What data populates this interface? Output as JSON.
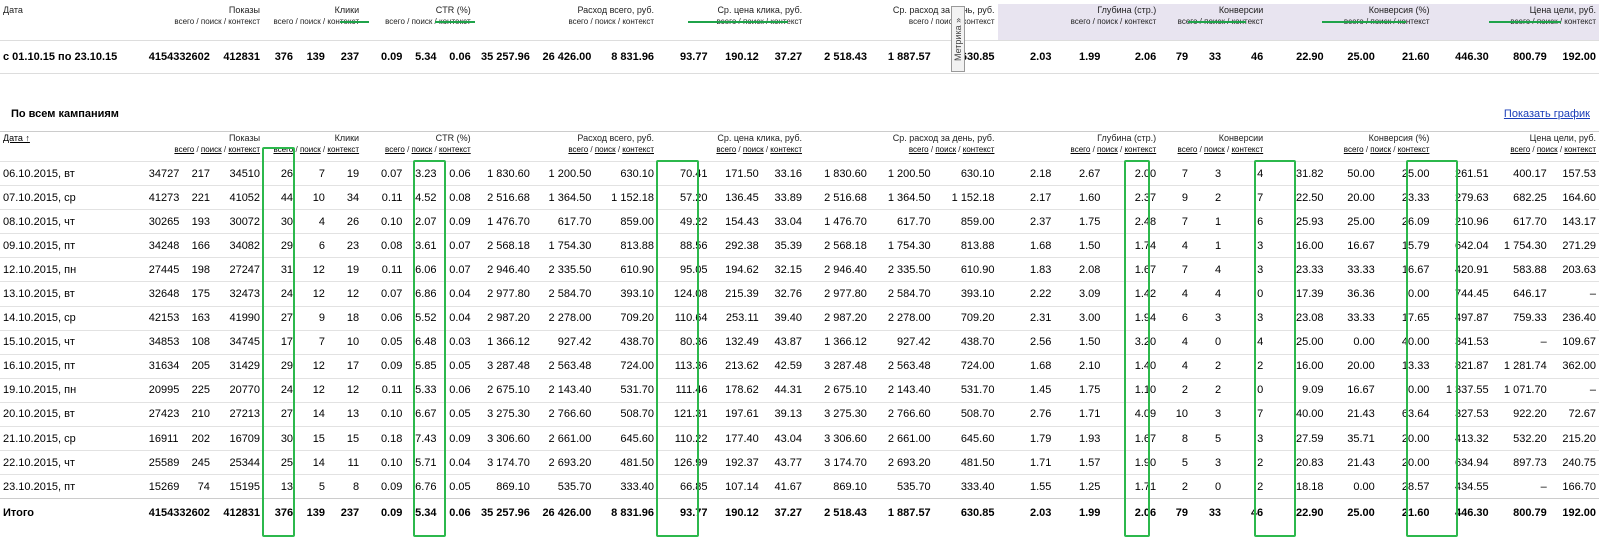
{
  "summary": {
    "date_header": "Дата",
    "subheader": "всего / поиск / контекст",
    "metrika_label": "Метрика »",
    "groups": [
      "Показы",
      "Клики",
      "CTR (%)",
      "Расход всего, руб.",
      "Ср. цена клика, руб.",
      "Ср. расход за день, руб.",
      "Глубина (стр.)",
      "Конверсии",
      "Конверсия (%)",
      "Цена цели, руб."
    ],
    "row": [
      "с 01.10.15 по 23.10.15",
      "415433",
      "2602",
      "412831",
      "376",
      "139",
      "237",
      "0.09",
      "5.34",
      "0.06",
      "35 257.96",
      "26 426.00",
      "8 831.96",
      "93.77",
      "190.12",
      "37.27",
      "2 518.43",
      "1 887.57",
      "630.85",
      "2.03",
      "1.99",
      "2.06",
      "79",
      "33",
      "46",
      "22.90",
      "25.00",
      "21.60",
      "446.30",
      "800.79",
      "192.00"
    ]
  },
  "section_title": "По всем кампаниям",
  "show_graph_link": "Показать график",
  "table": {
    "date_header": "Дата ↑",
    "sub_labels": [
      "всего",
      "поиск",
      "контекст"
    ],
    "groups": [
      "Показы",
      "Клики",
      "CTR (%)",
      "Расход всего, руб.",
      "Ср. цена клика, руб.",
      "Ср. расход за день, руб.",
      "Глубина (стр.)",
      "Конверсии",
      "Конверсия (%)",
      "Цена цели, руб."
    ],
    "rows": [
      [
        "06.10.2015, вт",
        "34727",
        "217",
        "34510",
        "26",
        "7",
        "19",
        "0.07",
        "3.23",
        "0.06",
        "1 830.60",
        "1 200.50",
        "630.10",
        "70.41",
        "171.50",
        "33.16",
        "1 830.60",
        "1 200.50",
        "630.10",
        "2.18",
        "2.67",
        "2.00",
        "7",
        "3",
        "4",
        "31.82",
        "50.00",
        "25.00",
        "261.51",
        "400.17",
        "157.53"
      ],
      [
        "07.10.2015, ср",
        "41273",
        "221",
        "41052",
        "44",
        "10",
        "34",
        "0.11",
        "4.52",
        "0.08",
        "2 516.68",
        "1 364.50",
        "1 152.18",
        "57.20",
        "136.45",
        "33.89",
        "2 516.68",
        "1 364.50",
        "1 152.18",
        "2.17",
        "1.60",
        "2.37",
        "9",
        "2",
        "7",
        "22.50",
        "20.00",
        "23.33",
        "279.63",
        "682.25",
        "164.60"
      ],
      [
        "08.10.2015, чт",
        "30265",
        "193",
        "30072",
        "30",
        "4",
        "26",
        "0.10",
        "2.07",
        "0.09",
        "1 476.70",
        "617.70",
        "859.00",
        "49.22",
        "154.43",
        "33.04",
        "1 476.70",
        "617.70",
        "859.00",
        "2.37",
        "1.75",
        "2.48",
        "7",
        "1",
        "6",
        "25.93",
        "25.00",
        "26.09",
        "210.96",
        "617.70",
        "143.17"
      ],
      [
        "09.10.2015, пт",
        "34248",
        "166",
        "34082",
        "29",
        "6",
        "23",
        "0.08",
        "3.61",
        "0.07",
        "2 568.18",
        "1 754.30",
        "813.88",
        "88.56",
        "292.38",
        "35.39",
        "2 568.18",
        "1 754.30",
        "813.88",
        "1.68",
        "1.50",
        "1.74",
        "4",
        "1",
        "3",
        "16.00",
        "16.67",
        "15.79",
        "642.04",
        "1 754.30",
        "271.29"
      ],
      [
        "12.10.2015, пн",
        "27445",
        "198",
        "27247",
        "31",
        "12",
        "19",
        "0.11",
        "6.06",
        "0.07",
        "2 946.40",
        "2 335.50",
        "610.90",
        "95.05",
        "194.62",
        "32.15",
        "2 946.40",
        "2 335.50",
        "610.90",
        "1.83",
        "2.08",
        "1.67",
        "7",
        "4",
        "3",
        "23.33",
        "33.33",
        "16.67",
        "420.91",
        "583.88",
        "203.63"
      ],
      [
        "13.10.2015, вт",
        "32648",
        "175",
        "32473",
        "24",
        "12",
        "12",
        "0.07",
        "6.86",
        "0.04",
        "2 977.80",
        "2 584.70",
        "393.10",
        "124.08",
        "215.39",
        "32.76",
        "2 977.80",
        "2 584.70",
        "393.10",
        "2.22",
        "3.09",
        "1.42",
        "4",
        "4",
        "0",
        "17.39",
        "36.36",
        "0.00",
        "744.45",
        "646.17",
        "–"
      ],
      [
        "14.10.2015, ср",
        "42153",
        "163",
        "41990",
        "27",
        "9",
        "18",
        "0.06",
        "5.52",
        "0.04",
        "2 987.20",
        "2 278.00",
        "709.20",
        "110.64",
        "253.11",
        "39.40",
        "2 987.20",
        "2 278.00",
        "709.20",
        "2.31",
        "3.00",
        "1.94",
        "6",
        "3",
        "3",
        "23.08",
        "33.33",
        "17.65",
        "497.87",
        "759.33",
        "236.40"
      ],
      [
        "15.10.2015, чт",
        "34853",
        "108",
        "34745",
        "17",
        "7",
        "10",
        "0.05",
        "6.48",
        "0.03",
        "1 366.12",
        "927.42",
        "438.70",
        "80.36",
        "132.49",
        "43.87",
        "1 366.12",
        "927.42",
        "438.70",
        "2.56",
        "1.50",
        "3.20",
        "4",
        "0",
        "4",
        "25.00",
        "0.00",
        "40.00",
        "341.53",
        "–",
        "109.67"
      ],
      [
        "16.10.2015, пт",
        "31634",
        "205",
        "31429",
        "29",
        "12",
        "17",
        "0.09",
        "5.85",
        "0.05",
        "3 287.48",
        "2 563.48",
        "724.00",
        "113.36",
        "213.62",
        "42.59",
        "3 287.48",
        "2 563.48",
        "724.00",
        "1.68",
        "2.10",
        "1.40",
        "4",
        "2",
        "2",
        "16.00",
        "20.00",
        "13.33",
        "821.87",
        "1 281.74",
        "362.00"
      ],
      [
        "19.10.2015, пн",
        "20995",
        "225",
        "20770",
        "24",
        "12",
        "12",
        "0.11",
        "5.33",
        "0.06",
        "2 675.10",
        "2 143.40",
        "531.70",
        "111.46",
        "178.62",
        "44.31",
        "2 675.10",
        "2 143.40",
        "531.70",
        "1.45",
        "1.75",
        "1.10",
        "2",
        "2",
        "0",
        "9.09",
        "16.67",
        "0.00",
        "1 337.55",
        "1 071.70",
        "–"
      ],
      [
        "20.10.2015, вт",
        "27423",
        "210",
        "27213",
        "27",
        "14",
        "13",
        "0.10",
        "6.67",
        "0.05",
        "3 275.30",
        "2 766.60",
        "508.70",
        "121.31",
        "197.61",
        "39.13",
        "3 275.30",
        "2 766.60",
        "508.70",
        "2.76",
        "1.71",
        "4.09",
        "10",
        "3",
        "7",
        "40.00",
        "21.43",
        "63.64",
        "327.53",
        "922.20",
        "72.67"
      ],
      [
        "21.10.2015, ср",
        "16911",
        "202",
        "16709",
        "30",
        "15",
        "15",
        "0.18",
        "7.43",
        "0.09",
        "3 306.60",
        "2 661.00",
        "645.60",
        "110.22",
        "177.40",
        "43.04",
        "3 306.60",
        "2 661.00",
        "645.60",
        "1.79",
        "1.93",
        "1.67",
        "8",
        "5",
        "3",
        "27.59",
        "35.71",
        "20.00",
        "413.32",
        "532.20",
        "215.20"
      ],
      [
        "22.10.2015, чт",
        "25589",
        "245",
        "25344",
        "25",
        "14",
        "11",
        "0.10",
        "5.71",
        "0.04",
        "3 174.70",
        "2 693.20",
        "481.50",
        "126.99",
        "192.37",
        "43.77",
        "3 174.70",
        "2 693.20",
        "481.50",
        "1.71",
        "1.57",
        "1.90",
        "5",
        "3",
        "2",
        "20.83",
        "21.43",
        "20.00",
        "634.94",
        "897.73",
        "240.75"
      ],
      [
        "23.10.2015, пт",
        "15269",
        "74",
        "15195",
        "13",
        "5",
        "8",
        "0.09",
        "6.76",
        "0.05",
        "869.10",
        "535.70",
        "333.40",
        "66.85",
        "107.14",
        "41.67",
        "869.10",
        "535.70",
        "333.40",
        "1.55",
        "1.25",
        "1.71",
        "2",
        "0",
        "2",
        "18.18",
        "0.00",
        "28.57",
        "434.55",
        "–",
        "166.70"
      ]
    ],
    "total_label": "Итого",
    "total": [
      "415433",
      "2602",
      "412831",
      "376",
      "139",
      "237",
      "0.09",
      "5.34",
      "0.06",
      "35 257.96",
      "26 426.00",
      "8 831.96",
      "93.77",
      "190.12",
      "37.27",
      "2 518.43",
      "1 887.57",
      "630.85",
      "2.03",
      "1.99",
      "2.06",
      "79",
      "33",
      "46",
      "22.90",
      "25.00",
      "21.60",
      "446.30",
      "800.79",
      "192.00"
    ]
  },
  "colors": {
    "highlight": "#2cb84c",
    "underline": "#1fa34a",
    "link": "#1a3db8",
    "shade": "#e8e4f0"
  }
}
